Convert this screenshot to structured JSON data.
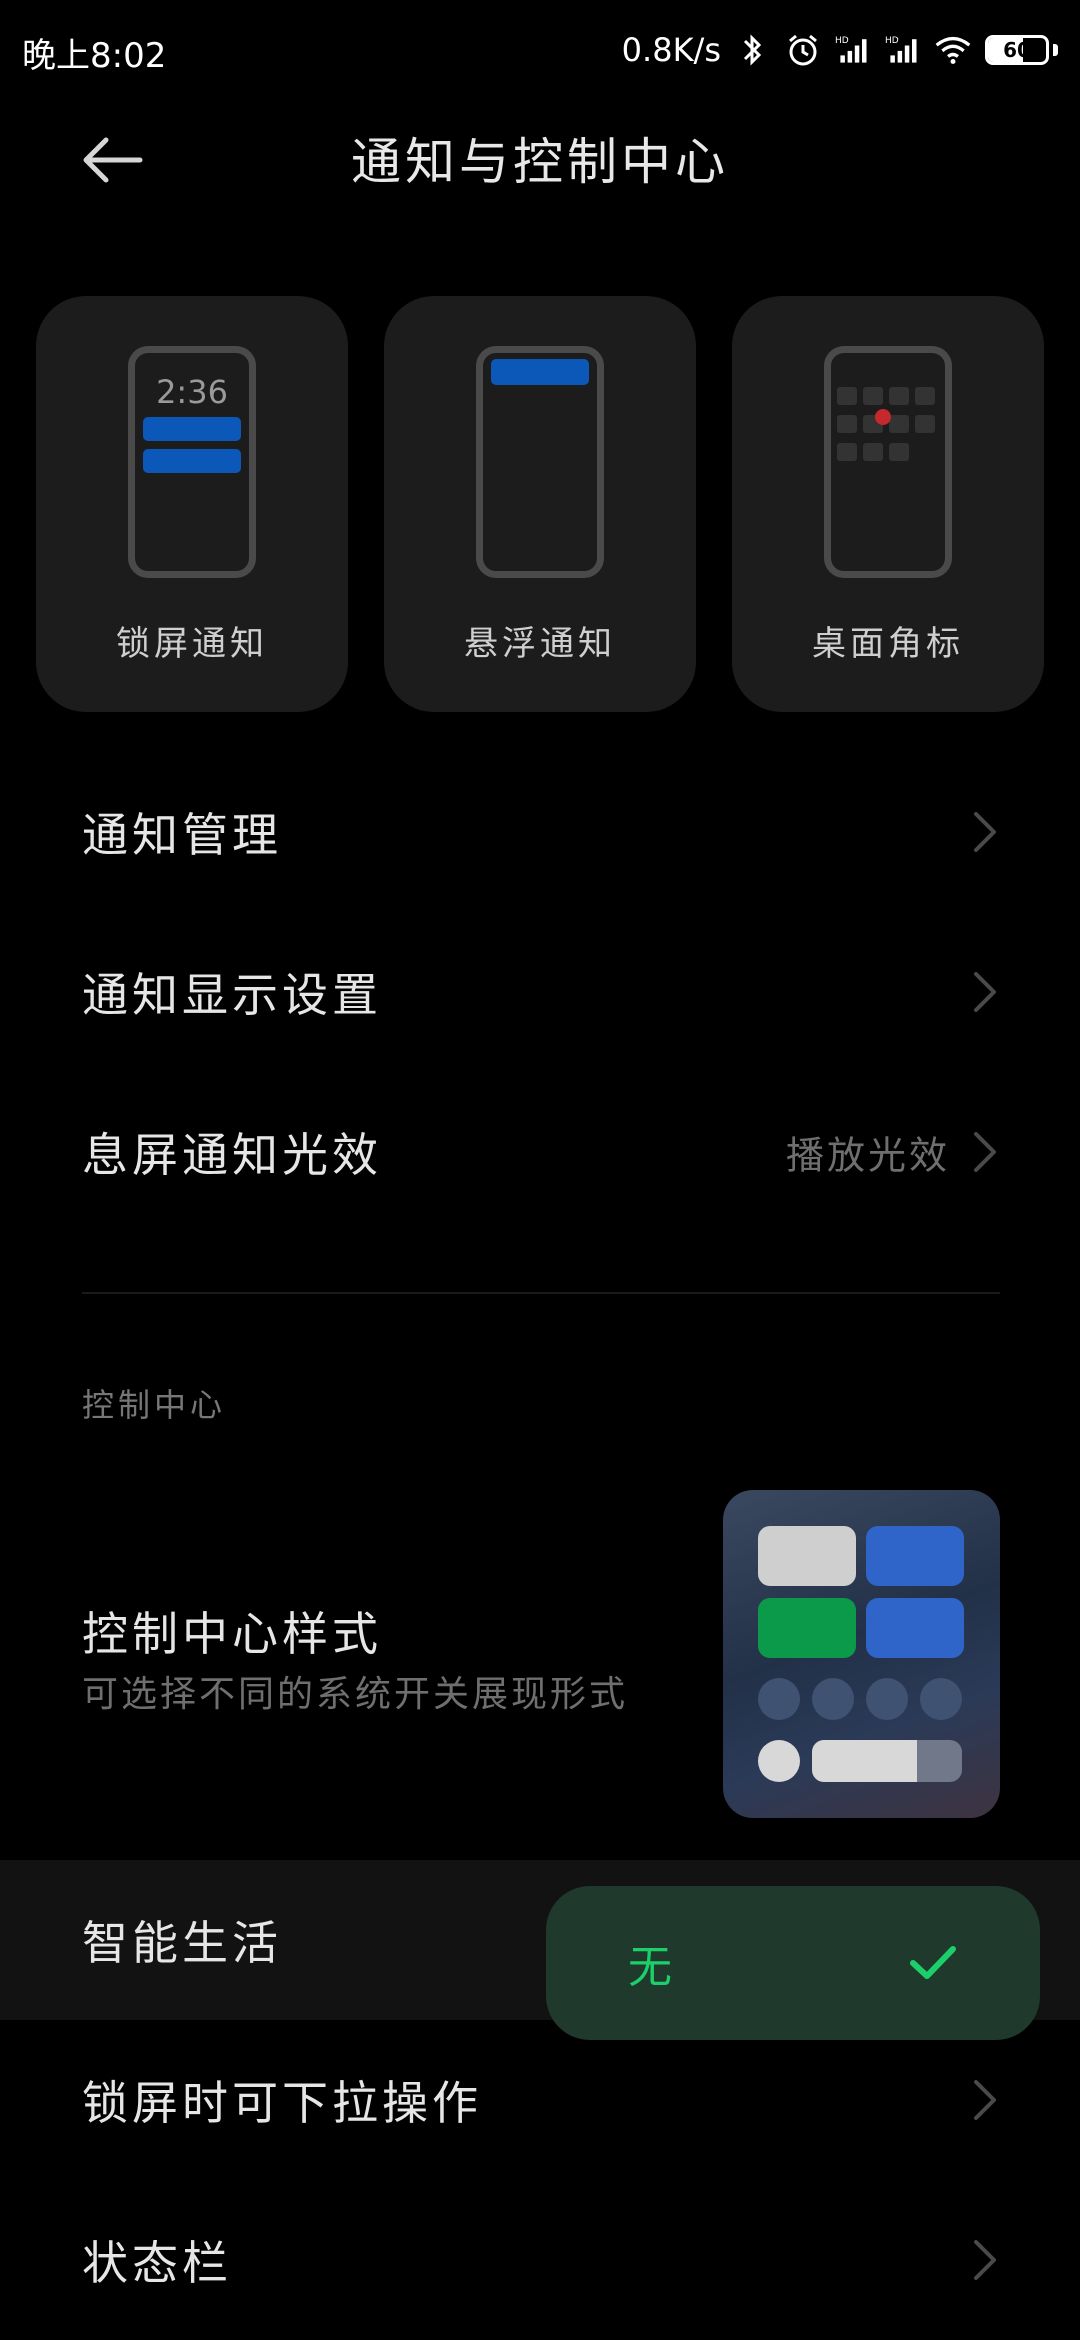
{
  "status_bar": {
    "time": "晚上8:02",
    "net_speed": "0.8K/s",
    "battery": "60"
  },
  "header": {
    "title": "通知与控制中心"
  },
  "cards": [
    {
      "label": "锁屏通知",
      "preview_time": "2:36"
    },
    {
      "label": "悬浮通知"
    },
    {
      "label": "桌面角标"
    }
  ],
  "rows": {
    "notification_management": "通知管理",
    "notification_display": "通知显示设置",
    "screen_off_light": {
      "label": "息屏通知光效",
      "value": "播放光效"
    },
    "smart_life": "智能生活",
    "lockscreen_pulldown": "锁屏时可下拉操作",
    "status_bar": "状态栏"
  },
  "control_center": {
    "section_label": "控制中心",
    "style_title": "控制中心样式",
    "style_subtitle": "可选择不同的系统开关展现形式"
  },
  "toast": {
    "text": "无"
  },
  "colors": {
    "background": "#000000",
    "card": "#1c1c1c",
    "accent_blue": "#0b58b8",
    "toast_bg": "#1f3a2c",
    "toast_text": "#1ccf6a"
  }
}
